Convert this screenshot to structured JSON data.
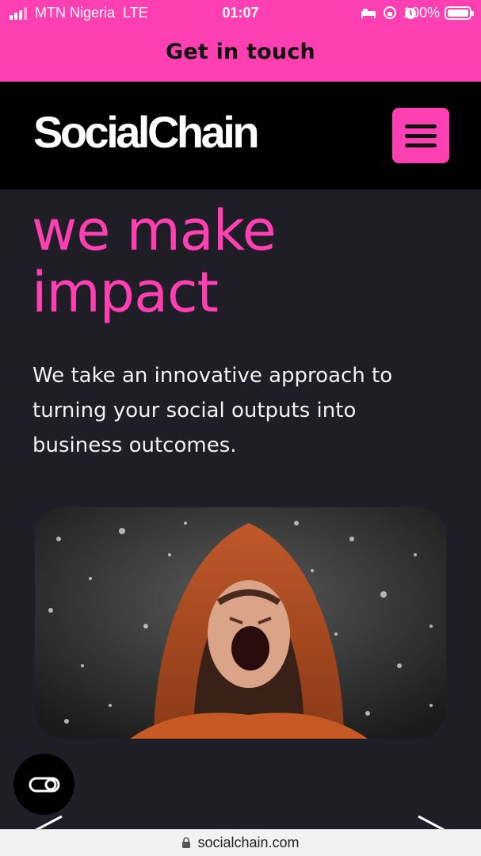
{
  "status_bar": {
    "carrier": "MTN Nigeria",
    "network": "LTE",
    "time": "01:07",
    "battery": "100%"
  },
  "banner": {
    "label": "Get in touch"
  },
  "header": {
    "logo": "SocialChain",
    "menu_icon": "hamburger-menu-icon"
  },
  "hero": {
    "headline_line1": "we make",
    "headline_line2": "impact",
    "description": "We take an innovative approach to turning your social outputs into business outcomes."
  },
  "url_bar": {
    "url": "socialchain.com"
  },
  "colors": {
    "brand_pink": "#ff40b3",
    "background": "#1f1d25",
    "header_bg": "#000000"
  }
}
